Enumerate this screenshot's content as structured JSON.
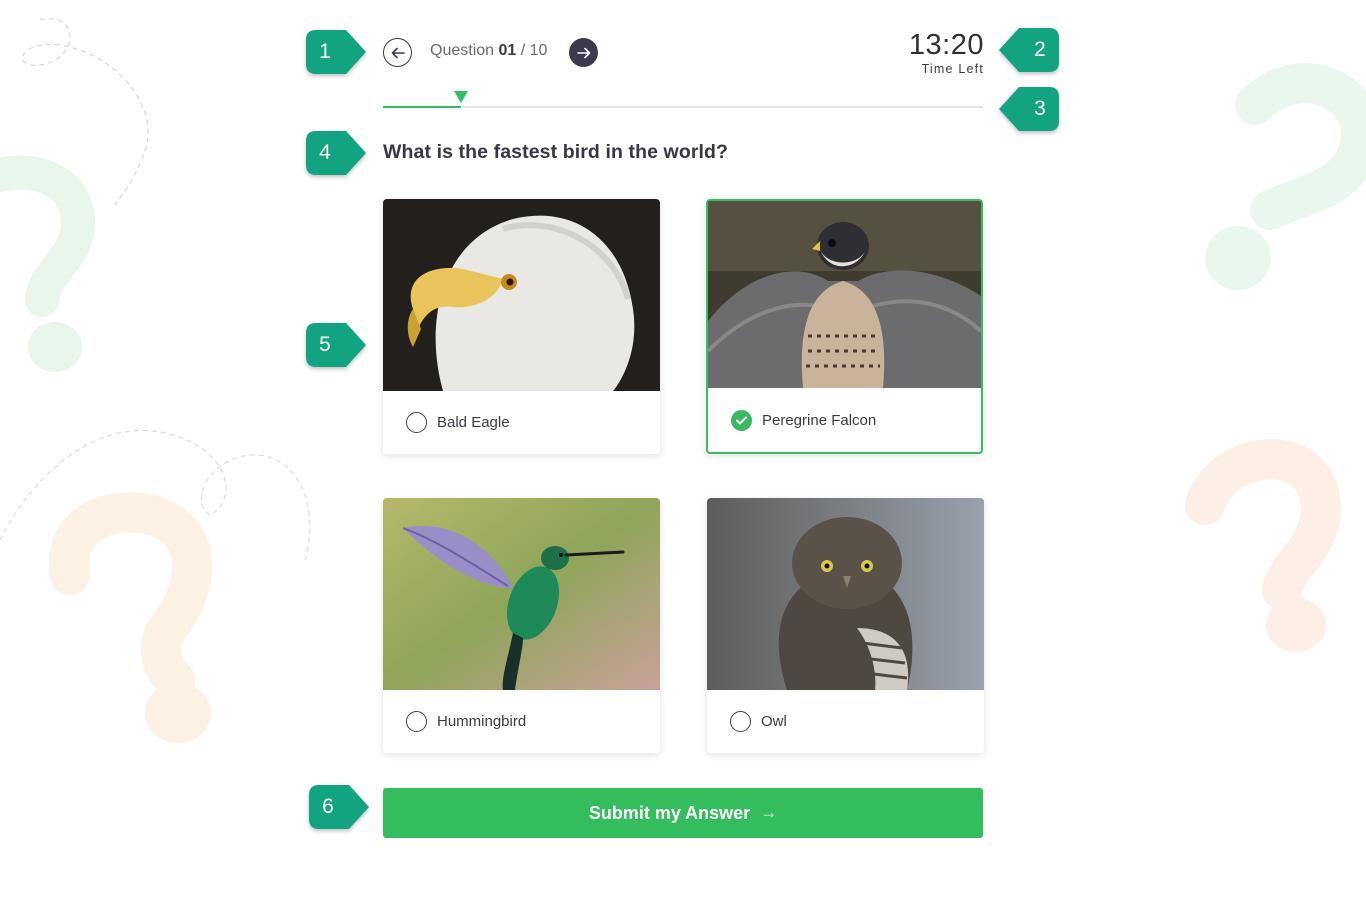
{
  "markers": [
    "1",
    "2",
    "3",
    "4",
    "5",
    "6"
  ],
  "header": {
    "question_label": "Question",
    "question_current": "01",
    "question_separator": "/ 10",
    "timer_value": "13:20",
    "timer_label": "Time Left"
  },
  "progress": {
    "fraction": 0.13
  },
  "question": "What is the fastest bird in the world?",
  "options": [
    {
      "label": "Bald Eagle",
      "image": "bald-eagle-photo",
      "selected": false
    },
    {
      "label": "Peregrine Falcon",
      "image": "peregrine-falcon-photo",
      "selected": true
    },
    {
      "label": "Hummingbird",
      "image": "hummingbird-photo",
      "selected": false
    },
    {
      "label": "Owl",
      "image": "owl-photo",
      "selected": false
    }
  ],
  "submit": {
    "label": "Submit my Answer",
    "icon": "arrow-right-icon"
  },
  "colors": {
    "accent": "#33bd5d",
    "marker": "#14a37f",
    "nav_dark": "#3b3a4f"
  }
}
